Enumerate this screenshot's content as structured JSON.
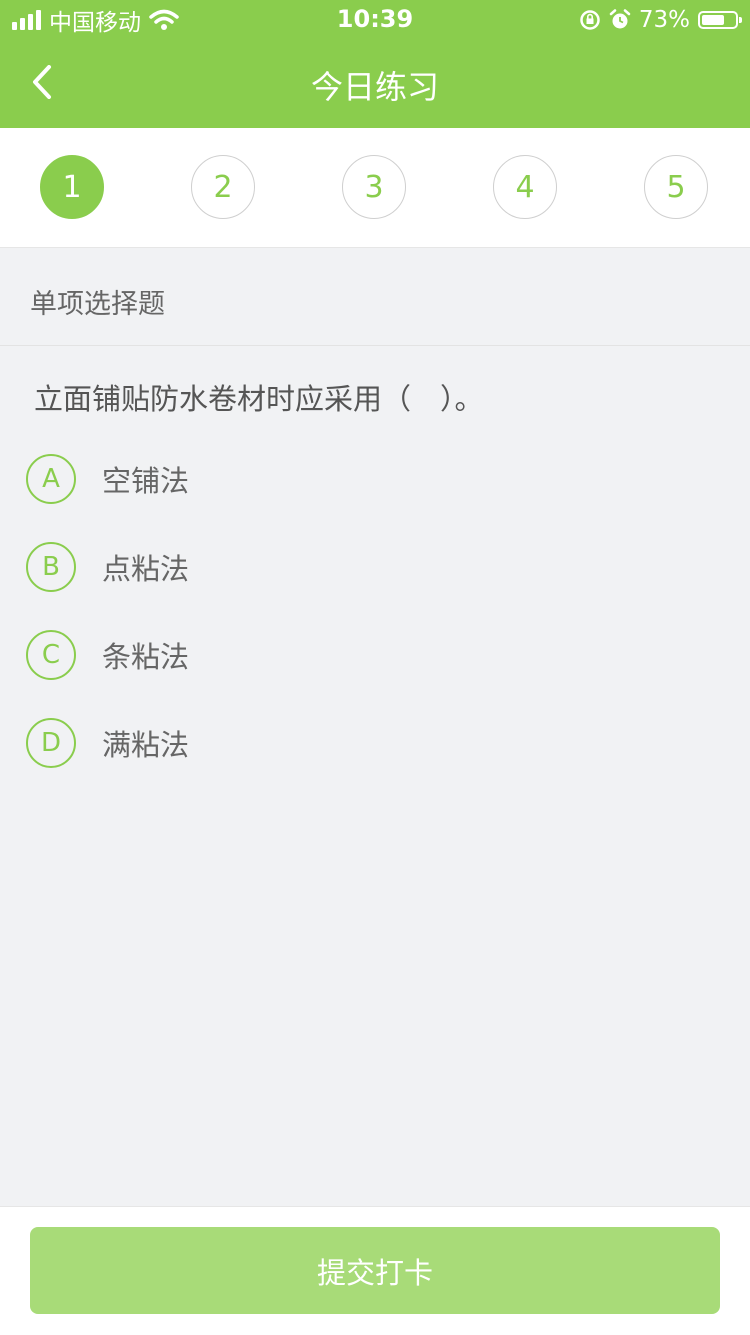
{
  "status_bar": {
    "carrier": "中国移动",
    "time": "10:39",
    "battery": "73%",
    "battery_level": 0.73
  },
  "navbar": {
    "title": "今日练习",
    "back_icon": "chevron-left-icon"
  },
  "steps": [
    {
      "label": "1",
      "active": true
    },
    {
      "label": "2",
      "active": false
    },
    {
      "label": "3",
      "active": false
    },
    {
      "label": "4",
      "active": false
    },
    {
      "label": "5",
      "active": false
    }
  ],
  "question_type": "单项选择题",
  "question": "立面铺贴防水卷材时应采用（　）。",
  "options": [
    {
      "letter": "A",
      "text": "空铺法"
    },
    {
      "letter": "B",
      "text": "点粘法"
    },
    {
      "letter": "C",
      "text": "条粘法"
    },
    {
      "letter": "D",
      "text": "满粘法"
    }
  ],
  "submit_label": "提交打卡",
  "colors": {
    "accent": "#8acd4d",
    "submit_disabled": "#a8db78",
    "background": "#f1f2f4"
  }
}
